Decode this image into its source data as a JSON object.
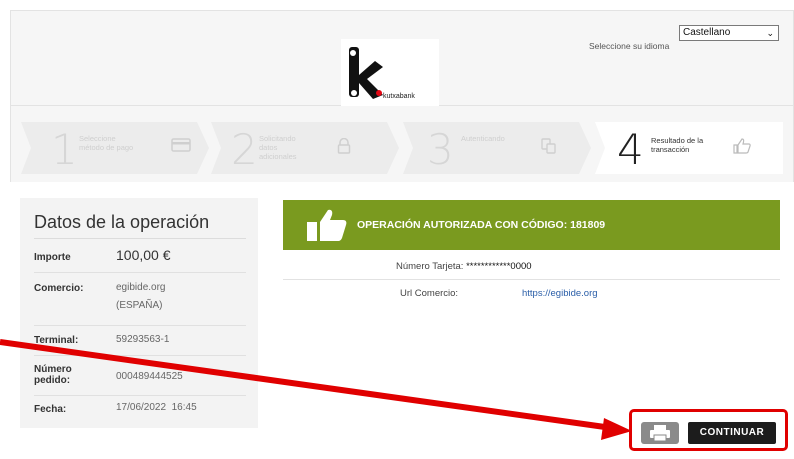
{
  "header": {
    "logo_text": "kutxabank",
    "lang_label": "Seleccione su idioma",
    "lang_value": "Castellano"
  },
  "steps": [
    {
      "num": "1",
      "label": "Seleccione método de pago",
      "icon": "card-icon",
      "active": false
    },
    {
      "num": "2",
      "label": "Solicitando datos adicionales",
      "icon": "lock-icon",
      "active": false
    },
    {
      "num": "3",
      "label": "Autenticando",
      "icon": "auth-icon",
      "active": false
    },
    {
      "num": "4",
      "label": "Resultado de la transacción",
      "icon": "thumbs-up-icon",
      "active": true
    }
  ],
  "operation": {
    "title": "Datos de la operación",
    "rows": [
      {
        "key": "Importe",
        "value": "100,00 €"
      },
      {
        "key": "Comercio:",
        "value": "egibide.org (ESPAÑA)"
      },
      {
        "key": "Terminal:",
        "value": "59293563-1"
      },
      {
        "key": "Número pedido:",
        "value": "000489444525"
      },
      {
        "key": "Fecha:",
        "value": "17/06/2022  16:45"
      }
    ]
  },
  "result": {
    "banner": "OPERACIÓN AUTORIZADA CON CÓDIGO: 181809",
    "card_label": "Número Tarjeta:",
    "card_value": "************0000",
    "url_label": "Url Comercio:",
    "url_value": "https://egibide.org"
  },
  "buttons": {
    "continue": "CONTINUAR",
    "print_icon": "printer-icon"
  },
  "colors": {
    "banner": "#7a9a1f",
    "highlight": "#e00000"
  }
}
